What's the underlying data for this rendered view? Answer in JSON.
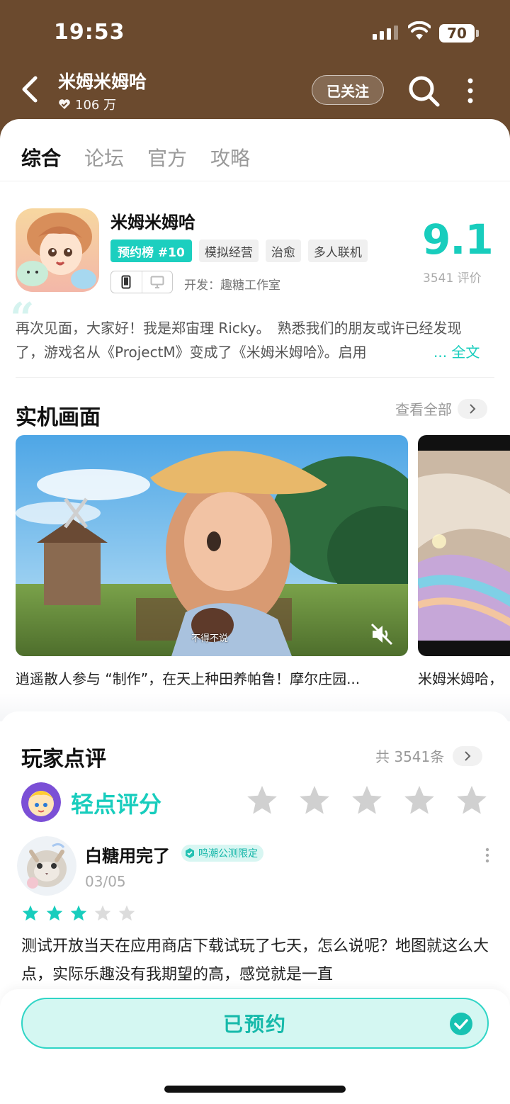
{
  "status": {
    "time": "19:53",
    "battery": "70"
  },
  "header": {
    "title": "米姆米姆哈",
    "fans": "106 万",
    "follow_label": "已关注"
  },
  "tabs": [
    "综合",
    "论坛",
    "官方",
    "攻略"
  ],
  "game": {
    "name": "米姆米姆哈",
    "rank_tag": "预约榜 #10",
    "tags": [
      "模拟经营",
      "治愈",
      "多人联机"
    ],
    "developer": "开发：趣糖工作室",
    "score": "9.1",
    "score_count": "3541 评价",
    "intro": "再次见面，大家好！我是郑宙理 Ricky。　熟悉我们的朋友或许已经发现了，游戏名从《ProjectM》变成了《米姆米姆哈》。启用",
    "intro_more": "... 全文"
  },
  "screens": {
    "title": "实机画面",
    "view_all": "查看全部",
    "items": [
      {
        "caption": "逍遥散人参与 “制作”，在天上种田养帕鲁！摩尔庄园...",
        "subtitle": "不得不说"
      },
      {
        "caption": "米姆米姆哈，"
      }
    ]
  },
  "reviews": {
    "title": "玩家点评",
    "count": "共 3541条",
    "tap_rate": "轻点评分",
    "rate_star_count": 5,
    "item": {
      "name": "白糖用完了",
      "badge": "鸣潮公测限定",
      "date": "03/05",
      "rating": 3,
      "rating_max": 5,
      "text": "测试开放当天在应用商店下载试玩了七天，怎么说呢？地图就这么大点，实际乐趣没有我期望的高，感觉就是一直"
    }
  },
  "bottom": {
    "reserve_label": "已预约"
  },
  "colors": {
    "accent": "#18cdbd",
    "header_bg": "#6b4a2e",
    "star_empty": "#d0d0d0"
  }
}
